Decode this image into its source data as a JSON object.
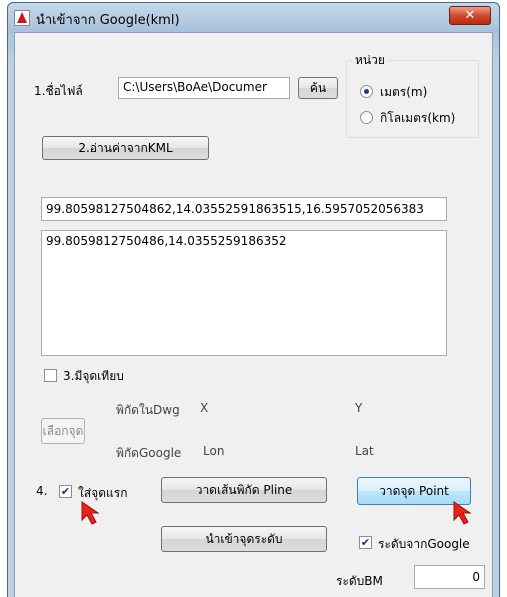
{
  "window": {
    "title": "นำเข้าจาก Google(kml)",
    "close_glyph": "✕"
  },
  "file": {
    "label": "1.ชื่อไฟล์",
    "path": "C:\\Users\\BoAe\\Documer",
    "browse_label": "ค้น"
  },
  "read_kml_label": "2.อ่านค่าจากKML",
  "units": {
    "title": "หน่วย",
    "options": [
      "เมตร(m)",
      "กิโลเมตร(km)"
    ],
    "selected": "เมตร(m)"
  },
  "coords_raw": "99.80598127504862,14.03552591863515,16.5957052056383",
  "coords_list": [
    "99.8059812750486,14.0355259186352"
  ],
  "reference_point": {
    "label": "3.มีจุดเทียบ",
    "checked": false,
    "select_point_label": "เลือกจุด",
    "dwg_label": "พิกัดในDwg",
    "x_label": "X",
    "y_label": "Y",
    "google_label": "พิกัดGoogle",
    "lon_label": "Lon",
    "lat_label": "Lat"
  },
  "step4": {
    "number": "4.",
    "first_point_label": "ใส่จุดแรก",
    "first_point_checked": true,
    "draw_pline_label": "วาดเส้นพิกัด Pline",
    "draw_point_label": "วาดจุด Point",
    "import_level_label": "นำเข้าจุดระดับ",
    "level_from_google_label": "ระดับจากGoogle",
    "level_from_google_checked": true,
    "bm_level_label": "ระดับBM",
    "bm_level_value": "0"
  },
  "check_glyph": "✔",
  "colors": {
    "pointer_red": "#e8231c",
    "close_red": "#d24a2e",
    "focus_blue": "#3c7fb1"
  }
}
